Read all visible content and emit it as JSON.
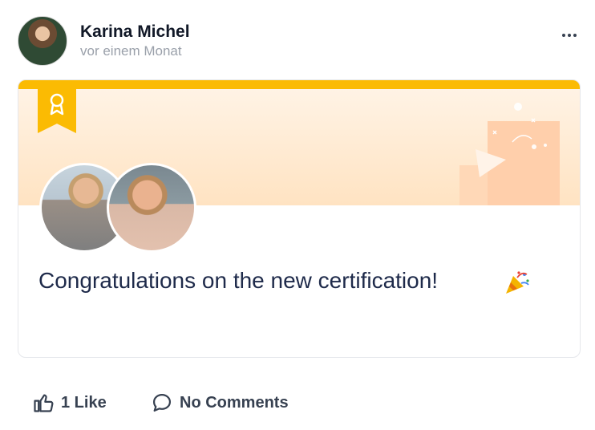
{
  "post": {
    "author": "Karina Michel",
    "timestamp": "vor einem Monat"
  },
  "card": {
    "message": "Congratulations on the new certification!",
    "accent_color": "#fbbb03",
    "banner_colors": [
      "#fff3e5",
      "#ffe3c2"
    ]
  },
  "actions": {
    "like_label": "1 Like",
    "comment_label": "No Comments"
  }
}
